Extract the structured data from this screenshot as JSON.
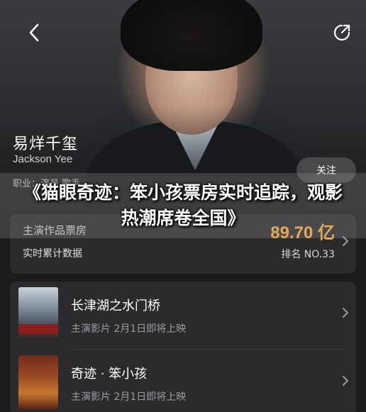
{
  "header": {
    "back_icon": "chevron-left-icon",
    "share_icon": "share-icon"
  },
  "profile": {
    "name_zh": "易烊千玺",
    "name_en": "Jackson Yee",
    "occupation": "职业：演员  歌手",
    "follow_label": "关注"
  },
  "stats": {
    "label": "主演作品票房",
    "sub_label": "实时累计数据",
    "value": "89.70 亿",
    "rank": "排名 NO.33"
  },
  "overlay": {
    "title": "《猫眼奇迹：笨小孩票房实时追踪，观影热潮席卷全国》"
  },
  "movies": [
    {
      "title": "长津湖之水门桥",
      "subtitle": "主演影片 2月1日即将上映"
    },
    {
      "title": "奇迹 · 笨小孩",
      "subtitle": "主演影片 2月1日即将上映"
    }
  ],
  "colors": {
    "accent": "#ffb23f",
    "card": "#2b2b2e",
    "background": "#1c1c1e"
  }
}
